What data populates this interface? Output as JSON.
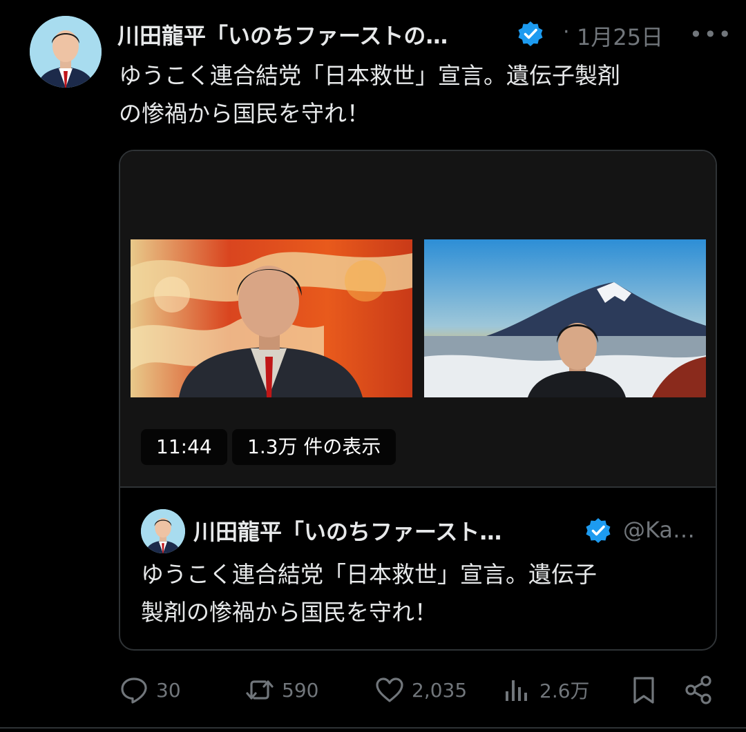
{
  "post": {
    "author_name": "川田龍平「いのちファーストの…",
    "separator": "·",
    "date": "1月25日",
    "more": "•••",
    "text_line1": "ゆうこく連合結党「日本救世」宣言。遺伝子製剤",
    "text_line2": "の惨禍から国民を守れ！"
  },
  "media": {
    "duration": "11:44",
    "views": "1.3万 件の表示"
  },
  "quoted": {
    "author_name": "川田龍平「いのちファースト…",
    "handle": "@Ka…",
    "text_line1": "ゆうこく連合結党「日本救世」宣言。遺伝子",
    "text_line2": "製剤の惨禍から国民を守れ！"
  },
  "actions": {
    "replies": "30",
    "reposts": "590",
    "likes": "2,035",
    "views": "2.6万"
  },
  "colors": {
    "background": "#000000",
    "text": "#e7e9ea",
    "secondary": "#71767b",
    "verified": "#1d9bf0",
    "border": "#2f3336"
  }
}
